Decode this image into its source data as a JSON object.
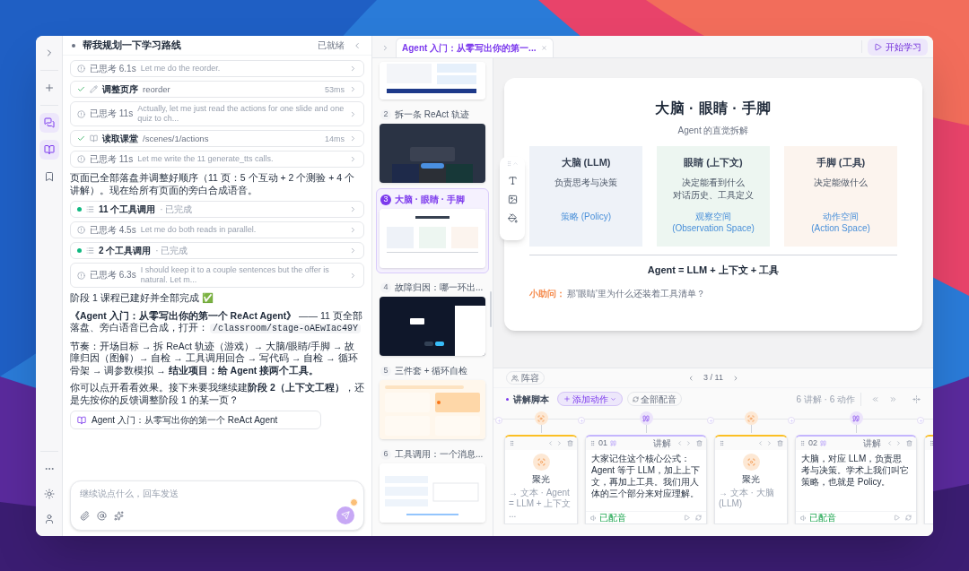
{
  "rail": {
    "top": [
      {
        "kind": "expand"
      },
      {
        "kind": "new"
      },
      {
        "kind": "chat",
        "selected": true
      },
      {
        "kind": "library",
        "selected": true
      },
      {
        "kind": "bookmark",
        "selected": false
      }
    ],
    "bottom": [
      {
        "kind": "more"
      },
      {
        "kind": "theme"
      },
      {
        "kind": "account"
      }
    ]
  },
  "chat": {
    "title": "帮我规划一下学习路线",
    "status": "已就绪",
    "feed": [
      {
        "kind": "thought",
        "label": "已思考 6.1s",
        "detail": "Let me do the reorder."
      },
      {
        "kind": "edit-tool",
        "done": true,
        "name": "调整页序",
        "detail": "reorder",
        "duration": "53ms"
      },
      {
        "kind": "thought",
        "label": "已思考 11s",
        "detail": "Actually, let me just read the actions for one slide and one quiz to ch..."
      },
      {
        "kind": "read-tool",
        "done": true,
        "name": "读取课堂",
        "detail": "/scenes/1/actions",
        "duration": "14ms"
      },
      {
        "kind": "thought",
        "label": "已思考 11s",
        "detail": "Let me write the 11 generate_tts calls."
      },
      {
        "kind": "text",
        "text": "页面已全部落盘并调整好顺序（11 页：5 个互动 + 2 个测验 + 4 个讲解）。现在给所有页面的旁白合成语音。"
      },
      {
        "kind": "group",
        "done": true,
        "title": "11 个工具调用",
        "status": "· 已完成"
      },
      {
        "kind": "thought",
        "label": "已思考 4.5s",
        "detail": "Let me do both reads in parallel."
      },
      {
        "kind": "group",
        "done": true,
        "title": "2 个工具调用",
        "status": "· 已完成"
      },
      {
        "kind": "thought",
        "label": "已思考 6.3s",
        "detail": "I should keep it to a couple sentences but the offer is natural. Let m..."
      },
      {
        "kind": "text",
        "text": "阶段 1 课程已建好并全部完成 ✅"
      },
      {
        "kind": "text",
        "text": "**《Agent 入门：从零写出你的第一个 ReAct Agent》** —— 11 页全部落盘、旁白语音已合成，打开：",
        "code": "/classroom/stage-oAEwIac49Y"
      },
      {
        "kind": "text",
        "text": "节奏：开场目标 → 拆 ReAct 轨迹（游戏）→ 大脑/眼睛/手脚 → 故障归因（图解）→ 自检 → 工具调用回合 → 写代码 → 自检 → 循环骨架 → 调参数模拟 → **结业项目：给 Agent 接两个工具。**"
      },
      {
        "kind": "text",
        "text": "你可以点开看看效果。接下来要我继续建**阶段 2（上下文工程）**，还是先按你的反馈调整阶段 1 的某一页？"
      },
      {
        "kind": "link",
        "text": "Agent 入门：从零写出你的第一个 ReAct Agent"
      }
    ],
    "input": {
      "placeholder": "继续说点什么，回车发送"
    }
  },
  "tab": {
    "label": "Agent 入门：从零写出你的第一...",
    "start": "开始学习"
  },
  "slides": [
    {
      "kind": "table",
      "selected": false
    },
    {
      "kind": "dark-cards",
      "number": "2",
      "title": "拆一条 ReAct 轨迹",
      "selected": false
    },
    {
      "kind": "three-columns",
      "number": "3",
      "title": "大脑 · 眼睛 · 手脚",
      "selected": true
    },
    {
      "kind": "dark-panel",
      "number": "4",
      "title": "故障归因：哪一环出...",
      "selected": false
    },
    {
      "kind": "orange-grid",
      "number": "5",
      "title": "三件套 + 循环自检",
      "selected": false
    },
    {
      "kind": "code-list",
      "number": "6",
      "title": "工具调用：一个消息...",
      "selected": false
    }
  ],
  "slide": {
    "title": "大脑 · 眼睛 · 手脚",
    "subtitle": "Agent 的直觉拆解",
    "columns": [
      {
        "title": "大脑 (LLM)",
        "desc": [
          "负责思考与决策"
        ],
        "term": [
          "策略 (Policy)"
        ],
        "color": "#eef2f8"
      },
      {
        "title": "眼睛 (上下文)",
        "desc": [
          "决定能看到什么",
          "对话历史、工具定义"
        ],
        "term": [
          "观察空间",
          "(Observation Space)"
        ],
        "color": "#edf6f1"
      },
      {
        "title": "手脚 (工具)",
        "desc": [
          "决定能做什么"
        ],
        "term": [
          "动作空间",
          "(Action Space)"
        ],
        "color": "#fcf4ee"
      }
    ],
    "formula": "Agent = LLM + 上下文 + 工具",
    "question_label": "小助问：",
    "question": "那'眼睛'里为什么还装着工具清单？"
  },
  "editor": {
    "team": "阵容",
    "page": "3 / 11",
    "script_title": "讲解脚本",
    "add_action": "添加动作",
    "voice_all": "全部配音",
    "counts": "6 讲解 · 6 动作",
    "cards": [
      {
        "kind": "focus",
        "label": "聚光",
        "target": "→ 文本 · Agent = LLM + 上下文 ..."
      },
      {
        "kind": "speech",
        "number": "01",
        "type": "讲解",
        "text": "大家记住这个核心公式：Agent 等于 LLM，加上上下文，再加上工具。我们用人体的三个部分来对应理解。",
        "voiced": true,
        "voice_status": "已配音"
      },
      {
        "kind": "focus",
        "label": "聚光",
        "target": "→ 文本 · 大脑 (LLM)"
      },
      {
        "kind": "speech",
        "number": "02",
        "type": "讲解",
        "text": "大脑，对应 LLM，负责思考与决策。学术上我们叫它策略，也就是 Policy。",
        "voiced": true,
        "voice_status": "已配音"
      },
      {
        "kind": "focus"
      }
    ]
  }
}
